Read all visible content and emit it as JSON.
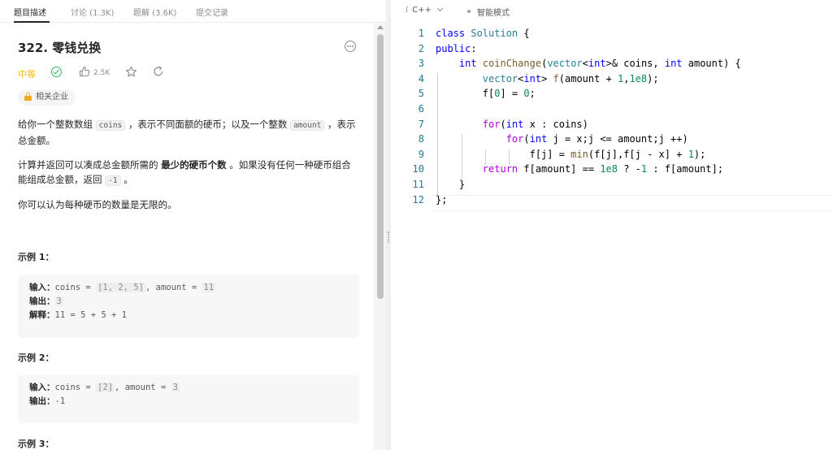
{
  "tabs": [
    {
      "label": "题目描述",
      "active": true
    },
    {
      "label": "讨论 (1.3K)",
      "active": false
    },
    {
      "label": "题解 (3.6K)",
      "active": false
    },
    {
      "label": "提交记录",
      "active": false
    }
  ],
  "problem": {
    "title": "322. 零钱兑换",
    "difficulty": "中等",
    "difficulty_color": "#ffb800",
    "likes": "2.5K",
    "company_tag": "相关企业",
    "desc1": {
      "a": "给你一个整数数组 ",
      "code_a": "coins",
      "b": " ，表示不同面额的硬币；以及一个整数 ",
      "code_b": "amount",
      "c": " ，表示总金额。"
    },
    "desc2": {
      "a": "计算并返回可以凑成总金额所需的 ",
      "strong": "最少的硬币个数",
      "b": " 。如果没有任何一种硬币组合能组成总金额，返回 ",
      "code": "-1",
      "c": " 。"
    },
    "desc3": "你可以认为每种硬币的数量是无限的。",
    "examples": [
      {
        "heading": "示例 1：",
        "input_label": "输入：",
        "input_pre": "coins = ",
        "input_code_a": "[1, 2, 5]",
        "input_mid": ", amount = ",
        "input_code_b": "11",
        "output_label": "输出：",
        "output": "3",
        "explain_label": "解释：",
        "explain": "11 = 5 + 5 + 1"
      },
      {
        "heading": "示例 2：",
        "input_label": "输入：",
        "input_pre": "coins = ",
        "input_code_a": "[2]",
        "input_mid": ", amount = ",
        "input_code_b": "3",
        "output_label": "输出：",
        "output": "-1"
      },
      {
        "heading": "示例 3："
      }
    ]
  },
  "editor": {
    "language": "C++",
    "info_glyph": "i",
    "mode_label": "智能模式",
    "line_numbers": [
      "1",
      "2",
      "3",
      "4",
      "5",
      "6",
      "7",
      "8",
      "9",
      "10",
      "11",
      "12"
    ]
  },
  "icons": {
    "more": "more-options-icon",
    "solved": "check-circle-icon",
    "like": "thumbs-up-icon",
    "star": "star-icon",
    "share": "share-icon",
    "lock": "lock-icon",
    "chevron": "chevron-down-icon"
  },
  "colors": {
    "keyword": "#0000ff",
    "type": "#267f99",
    "function": "#795e26",
    "number": "#098658",
    "control": "#af00db",
    "line_number": "#237893",
    "solved": "#2db55d"
  }
}
